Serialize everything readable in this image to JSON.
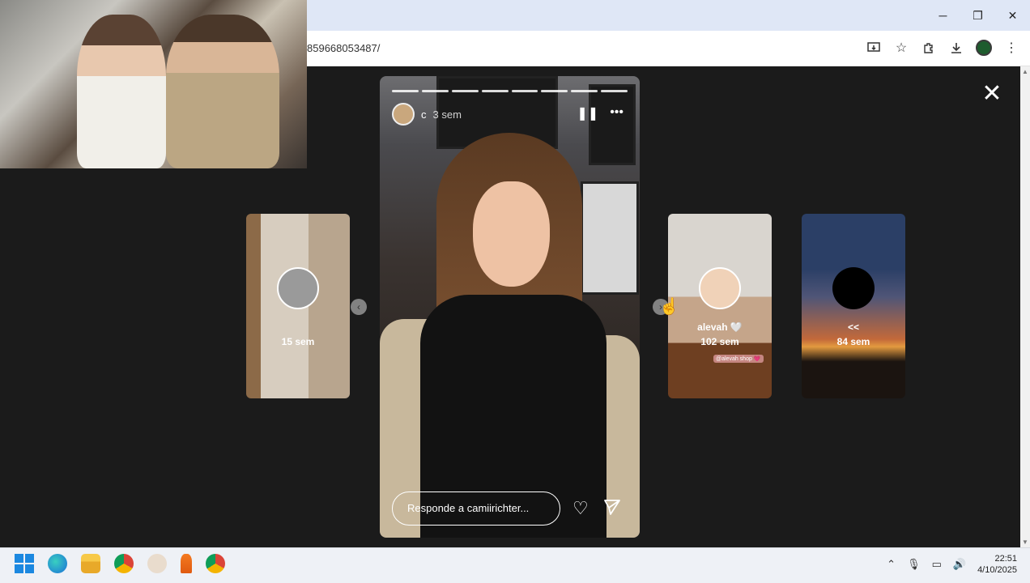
{
  "browser": {
    "url": "859668053487/",
    "window_controls": [
      "─",
      "❐",
      "✕"
    ],
    "toolbar_icons": [
      "install-icon",
      "bookmark-star-icon",
      "extensions-icon",
      "downloads-icon",
      "profile-icon",
      "menu-icon"
    ]
  },
  "viewer": {
    "close_label": "✕"
  },
  "story": {
    "username": "c",
    "time": "3 sem",
    "progress_segments": 8,
    "reply_placeholder": "Responde a camiirichter...",
    "controls": {
      "pause": "❚❚",
      "more": "•••"
    }
  },
  "thumbnails": [
    {
      "name": "",
      "time": "15 sem"
    },
    {
      "name": "alevah 🤍",
      "time": "102 sem",
      "sticker": "@alevah shop 💗"
    },
    {
      "name": "<<",
      "time": "84 sem"
    }
  ],
  "nav": {
    "prev": "‹",
    "next": "›"
  },
  "taskbar": {
    "time": "22:51",
    "date": "4/10/2025",
    "apps": [
      "windows-start-icon",
      "edge-icon",
      "file-explorer-icon",
      "chrome-icon",
      "app-red-dot-icon",
      "podcast-mic-icon",
      "chrome-profile-icon"
    ]
  }
}
